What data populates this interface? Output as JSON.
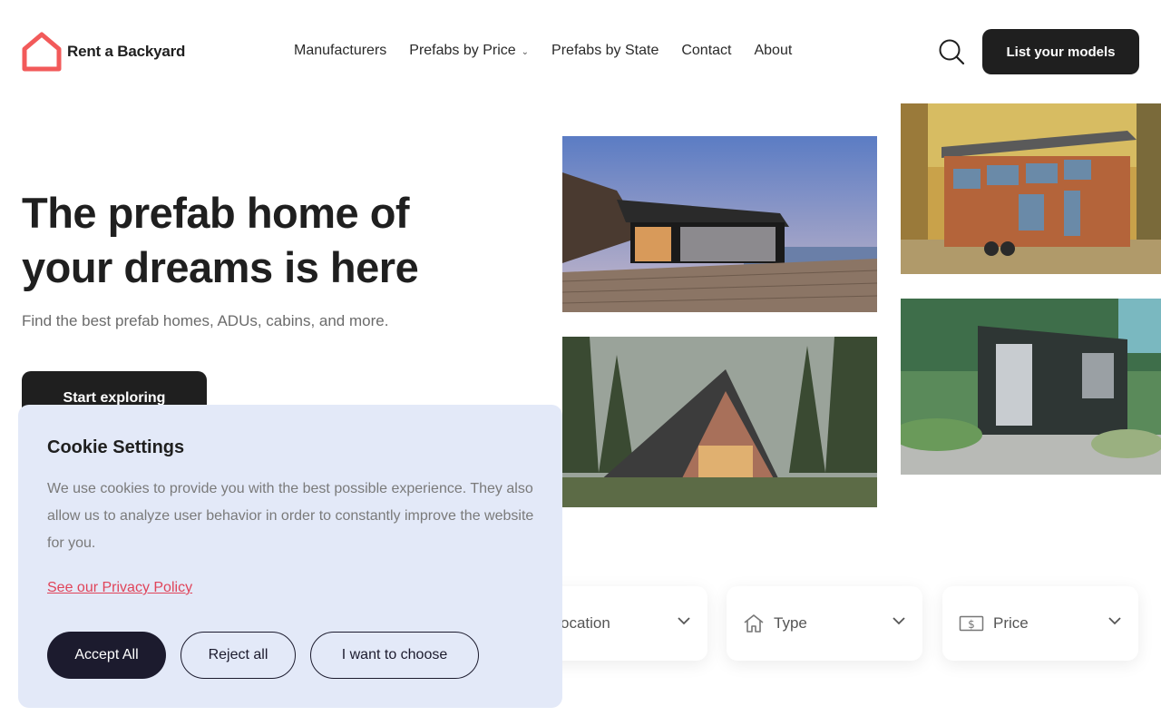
{
  "brand": {
    "name": "Rent a Backyard",
    "accent": "#f25a5a"
  },
  "nav": {
    "items": [
      {
        "label": "Manufacturers"
      },
      {
        "label": "Prefabs by Price",
        "has_dropdown": true
      },
      {
        "label": "Prefabs by State"
      },
      {
        "label": "Contact"
      },
      {
        "label": "About"
      }
    ]
  },
  "header": {
    "search_icon": "search-icon",
    "cta_label": "List your models"
  },
  "hero": {
    "title_line1": "The prefab home of",
    "title_line2": "your dreams is here",
    "subtitle": "Find the best prefab homes, ADUs, cabins, and more.",
    "cta_label": "Start exploring"
  },
  "gallery": {
    "images": [
      {
        "subject": "modern glass home with deck at ocean sunset"
      },
      {
        "subject": "wooden tiny house on wheels in autumn forest"
      },
      {
        "subject": "black A-frame cabin in pine forest"
      },
      {
        "subject": "dark shipping container home with glass doors"
      }
    ]
  },
  "filters": {
    "location": {
      "label": "Location",
      "visible_label": "ocation",
      "icon": "location-icon"
    },
    "type": {
      "label": "Type",
      "icon": "house-icon"
    },
    "price": {
      "label": "Price",
      "icon": "dollar-bill-icon"
    }
  },
  "cookie": {
    "title": "Cookie Settings",
    "text": "We use cookies to provide you with the best possible experience. They also allow us to analyze user behavior in order to constantly improve the website for you.",
    "policy_link": "See our Privacy Policy",
    "accept_label": "Accept All",
    "reject_label": "Reject all",
    "choose_label": "I want to choose",
    "colors": {
      "background": "#e3e9f8",
      "primary": "#1c1b2e",
      "link": "#e0445a"
    }
  }
}
